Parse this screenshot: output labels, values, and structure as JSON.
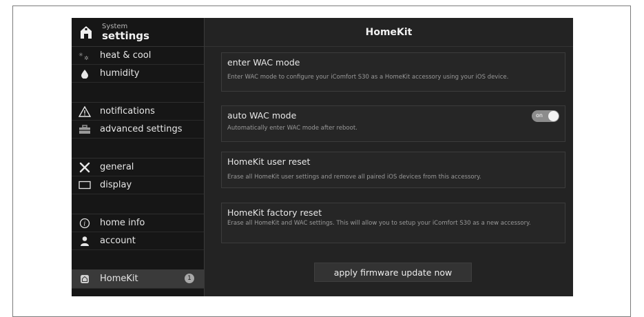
{
  "sidebar": {
    "title_small": "System",
    "title_large": "settings",
    "items": [
      {
        "label": "heat & cool",
        "icon": "heat-cool-icon"
      },
      {
        "label": "humidity",
        "icon": "droplet-icon"
      },
      {
        "label": "notifications",
        "icon": "warning-triangle-icon"
      },
      {
        "label": "advanced settings",
        "icon": "toolbox-icon"
      },
      {
        "label": "general",
        "icon": "tools-icon"
      },
      {
        "label": "display",
        "icon": "display-icon"
      },
      {
        "label": "home info",
        "icon": "info-icon"
      },
      {
        "label": "account",
        "icon": "person-icon"
      },
      {
        "label": "HomeKit",
        "icon": "homekit-icon",
        "badge": "1",
        "active": true
      }
    ]
  },
  "main": {
    "title": "HomeKit",
    "cards": [
      {
        "title": "enter WAC mode",
        "desc": "Enter WAC mode to configure your iComfort S30 as a HomeKit accessory using your iOS device."
      },
      {
        "title": "auto WAC mode",
        "desc": "Automatically enter WAC mode after reboot.",
        "toggle": {
          "label": "on",
          "state": "on"
        }
      },
      {
        "title": "HomeKit user reset",
        "desc": "Erase all HomeKit user settings and remove all paired iOS devices from this accessory."
      },
      {
        "title": "HomeKit factory reset",
        "desc": "Erase all HomeKit and WAC settings. This will allow you to setup your iComfort S30 as a new accessory."
      }
    ],
    "firmware_button": "apply firmware update now"
  },
  "colors": {
    "screen_bg": "#232323",
    "sidebar_bg": "#161616",
    "active_item_bg": "#3a3a3a",
    "toggle_on": "#8c8c8c"
  }
}
